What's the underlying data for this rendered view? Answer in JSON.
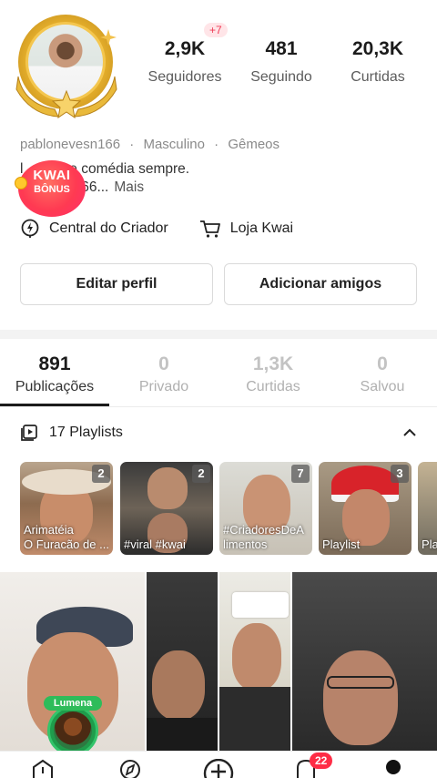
{
  "profile": {
    "username": "pablonevesn166",
    "gender": "Masculino",
    "sign": "Gêmeos",
    "bio_line1": "l      nal e comédia sempre.",
    "bio_line2": "      vesn166...",
    "bio_more": "Mais",
    "avatar_badge": "gold-laurel-frame"
  },
  "stats": {
    "followers_count": "2,9K",
    "followers_label": "Seguidores",
    "followers_delta": "+7",
    "following_count": "481",
    "following_label": "Seguindo",
    "likes_count": "20,3K",
    "likes_label": "Curtidas"
  },
  "kwai_bonus": {
    "line1": "KWAI",
    "line2": "BÔNUS"
  },
  "tools": {
    "creator_center": "Central do Criador",
    "shop": "Loja Kwai"
  },
  "actions": {
    "edit_profile": "Editar perfil",
    "add_friends": "Adicionar amigos"
  },
  "tabs": [
    {
      "count": "891",
      "label": "Publicações",
      "active": true
    },
    {
      "count": "0",
      "label": "Privado",
      "active": false
    },
    {
      "count": "1,3K",
      "label": "Curtidas",
      "active": false
    },
    {
      "count": "0",
      "label": "Salvou",
      "active": false
    }
  ],
  "playlists": {
    "header": "17 Playlists",
    "items": [
      {
        "count": "2",
        "caption_line1": "Arimatéia",
        "caption_line2": "O Furacão de ..."
      },
      {
        "count": "2",
        "caption_line1": "",
        "caption_line2": "#viral #kwai"
      },
      {
        "count": "7",
        "caption_line1": "#CriadoresDeA",
        "caption_line2": "limentos"
      },
      {
        "count": "3",
        "caption_line1": "",
        "caption_line2": "Playlist"
      },
      {
        "count": "",
        "caption_line1": "",
        "caption_line2": "Pla"
      }
    ]
  },
  "videos": {
    "live_tag": "Lumena"
  },
  "nav": {
    "notifications_badge": "22",
    "icons": [
      "home-icon",
      "discover-icon",
      "create-icon",
      "notifications-icon",
      "profile-icon"
    ]
  },
  "colors": {
    "accent": "#ff2d46",
    "gold": "#f4c64e",
    "bonus_red": "#ff3a52",
    "live_green": "#2ebc5a"
  }
}
